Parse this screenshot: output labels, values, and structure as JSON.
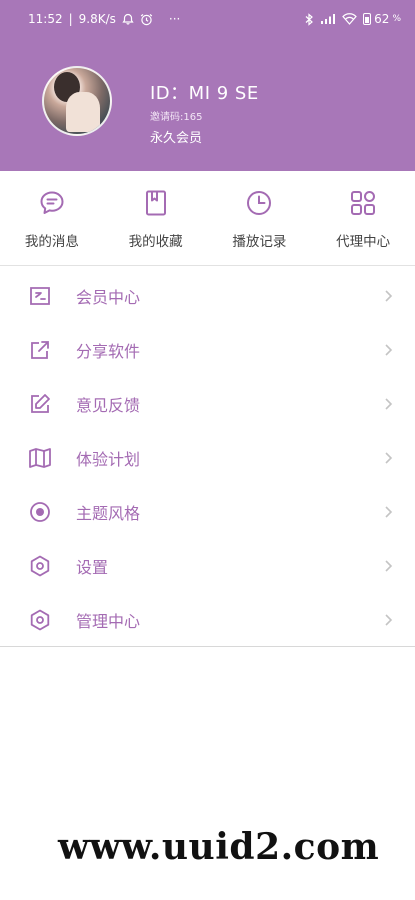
{
  "status_bar": {
    "time": "11:52",
    "net_speed": "9.8K/s",
    "more": "···",
    "battery": "62"
  },
  "profile": {
    "id_text": "ID：MI 9 SE",
    "invite_code": "邀请码:165",
    "membership": "永久会员"
  },
  "quick_actions": [
    {
      "label": "我的消息",
      "icon": "message-icon"
    },
    {
      "label": "我的收藏",
      "icon": "bookmark-icon"
    },
    {
      "label": "播放记录",
      "icon": "clock-icon"
    },
    {
      "label": "代理中心",
      "icon": "grid-icon"
    }
  ],
  "menu": [
    {
      "label": "会员中心",
      "icon": "member-card-icon"
    },
    {
      "label": "分享软件",
      "icon": "share-icon"
    },
    {
      "label": "意见反馈",
      "icon": "edit-icon"
    },
    {
      "label": "体验计划",
      "icon": "book-icon"
    },
    {
      "label": "主题风格",
      "icon": "target-icon"
    },
    {
      "label": "设置",
      "icon": "settings-icon"
    },
    {
      "label": "管理中心",
      "icon": "admin-icon"
    }
  ],
  "watermark": "www.uuid2.com",
  "colors": {
    "header_bg": "#a877b8",
    "accent": "#a46bb3"
  }
}
